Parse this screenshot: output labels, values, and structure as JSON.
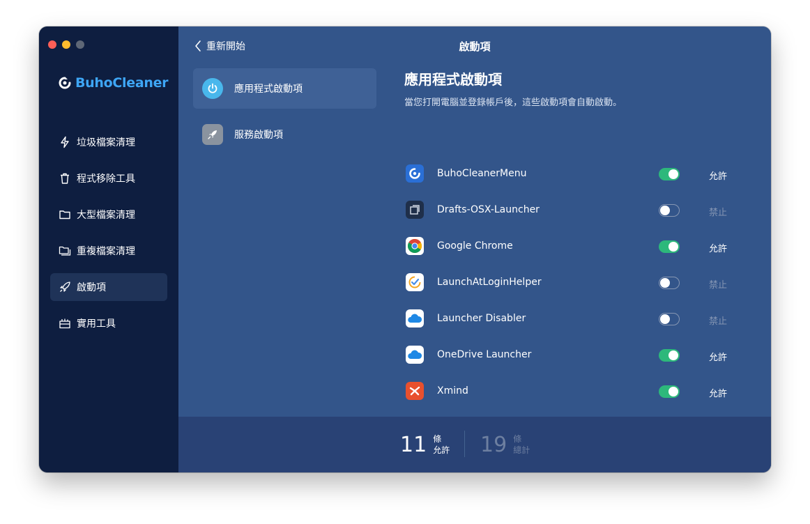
{
  "sidebar": {
    "logo_text": "BuhoCleaner",
    "items": [
      {
        "label": "垃圾檔案清理",
        "icon": "lightning-icon"
      },
      {
        "label": "程式移除工具",
        "icon": "trash-icon"
      },
      {
        "label": "大型檔案清理",
        "icon": "folder-icon"
      },
      {
        "label": "重複檔案清理",
        "icon": "duplicate-folder-icon"
      },
      {
        "label": "啟動項",
        "icon": "rocket-icon",
        "active": true
      },
      {
        "label": "實用工具",
        "icon": "toolbox-icon"
      }
    ]
  },
  "header": {
    "back_label": "重新開始",
    "title": "啟動項"
  },
  "categories": [
    {
      "label": "應用程式啟動項",
      "icon": "power-icon",
      "active": true
    },
    {
      "label": "服務啟動項",
      "icon": "rocket-icon"
    }
  ],
  "section": {
    "title": "應用程式啟動項",
    "description": "當您打開電腦並登錄帳戶後，這些啟動項會自動啟動。"
  },
  "apps": [
    {
      "name": "BuhoCleanerMenu",
      "enabled": true,
      "status": "允許",
      "icon": "buhocleaner-icon"
    },
    {
      "name": "Drafts-OSX-Launcher",
      "enabled": false,
      "status": "禁止",
      "icon": "drafts-icon"
    },
    {
      "name": "Google Chrome",
      "enabled": true,
      "status": "允許",
      "icon": "chrome-icon"
    },
    {
      "name": "LaunchAtLoginHelper",
      "enabled": false,
      "status": "禁止",
      "icon": "check-clock-icon"
    },
    {
      "name": "Launcher Disabler",
      "enabled": false,
      "status": "禁止",
      "icon": "cloud-icon"
    },
    {
      "name": "OneDrive Launcher",
      "enabled": true,
      "status": "允許",
      "icon": "onedrive-icon"
    },
    {
      "name": "Xmind",
      "enabled": true,
      "status": "允許",
      "icon": "xmind-icon"
    }
  ],
  "footer": {
    "allowed_count": "11",
    "allowed_unit": "條",
    "allowed_label": "允許",
    "total_count": "19",
    "total_unit": "條",
    "total_label": "總計"
  },
  "colors": {
    "sidebar_bg": "#0e1e40",
    "content_bg": "#33558a",
    "footer_bg": "#294275",
    "toggle_on": "#2db87b",
    "logo_blue": "#3ea6f5"
  }
}
